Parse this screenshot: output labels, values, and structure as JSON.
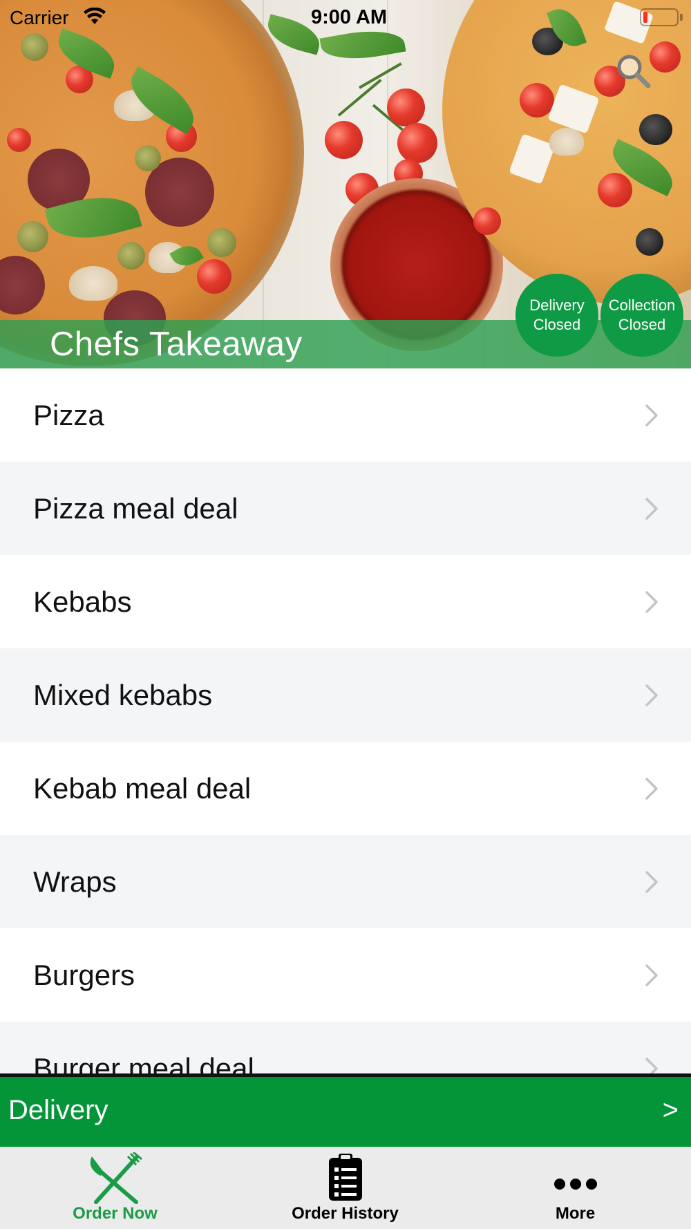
{
  "status_bar": {
    "carrier": "Carrier",
    "time": "9:00 AM"
  },
  "header": {
    "restaurant_name": "Chefs Takeaway",
    "delivery_status": {
      "line1": "Delivery",
      "line2": "Closed"
    },
    "collection_status": {
      "line1": "Collection",
      "line2": "Closed"
    },
    "search_icon": "search-icon"
  },
  "menu": {
    "categories": [
      {
        "label": "Pizza"
      },
      {
        "label": "Pizza meal deal"
      },
      {
        "label": "Kebabs"
      },
      {
        "label": "Mixed kebabs"
      },
      {
        "label": "Kebab meal deal"
      },
      {
        "label": "Wraps"
      },
      {
        "label": "Burgers"
      },
      {
        "label": "Burger meal deal"
      }
    ]
  },
  "order_mode": {
    "label": "Delivery",
    "arrow": ">"
  },
  "tab_bar": {
    "tabs": [
      {
        "label": "Order Now",
        "icon": "fork-knife-icon",
        "active": true
      },
      {
        "label": "Order History",
        "icon": "clipboard-list-icon",
        "active": false
      },
      {
        "label": "More",
        "icon": "more-dots-icon",
        "active": false
      }
    ]
  },
  "colors": {
    "brand_green": "#049539",
    "badge_green": "#0f9a45",
    "active_tab": "#1a9c47",
    "battery_low": "#ff2d20"
  }
}
